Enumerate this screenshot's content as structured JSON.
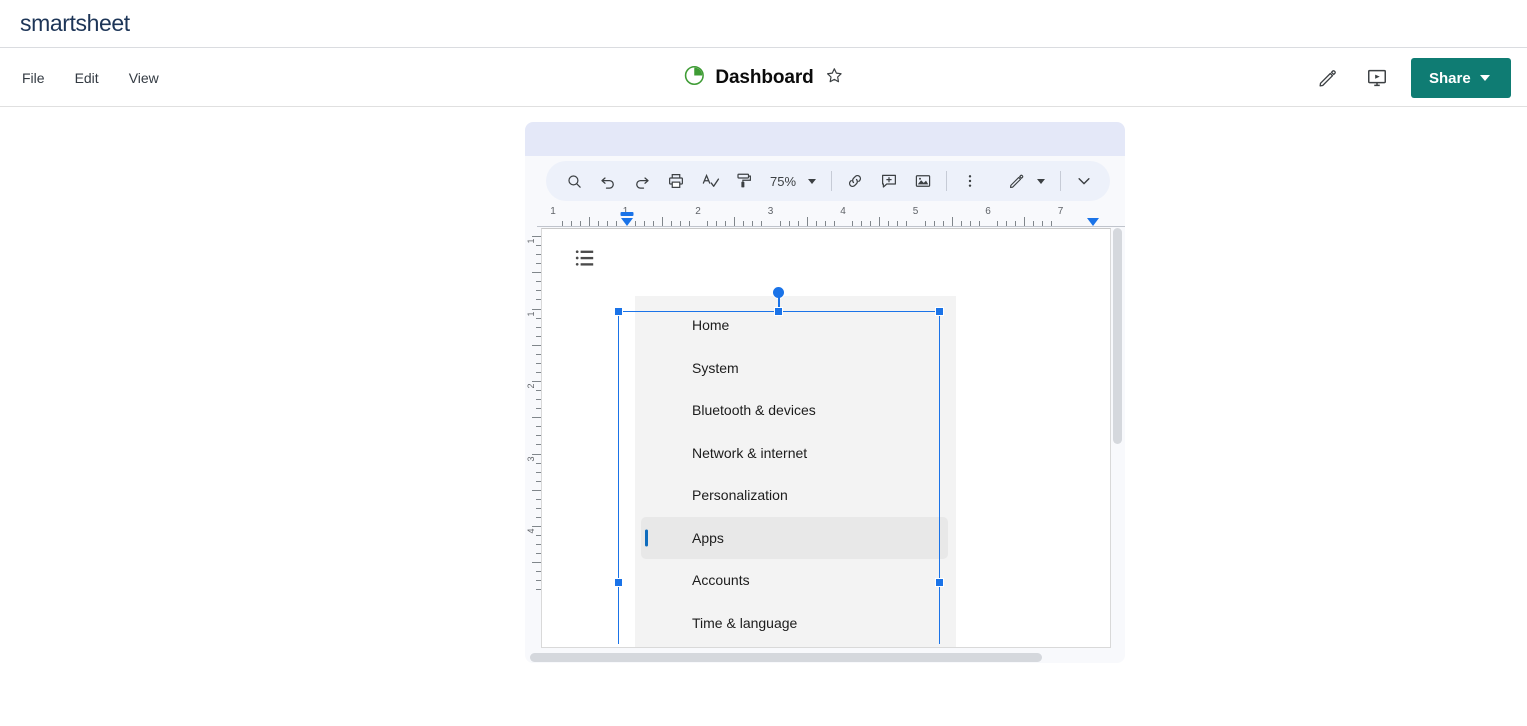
{
  "brand": {
    "name": "smartsheet",
    "color": "#1d3557"
  },
  "header": {
    "menus": [
      {
        "label": "File",
        "name": "menu-file"
      },
      {
        "label": "Edit",
        "name": "menu-edit"
      },
      {
        "label": "View",
        "name": "menu-view"
      }
    ],
    "title": "Dashboard",
    "title_icon": "pie-chart-icon",
    "star_icon": "star-outline-icon",
    "actions": [
      {
        "label": "Edit",
        "icon": "pencil-icon"
      },
      {
        "label": "Presentation mode",
        "icon": "presentation-icon"
      }
    ],
    "share": {
      "label": "Share",
      "color": "#0f7c73",
      "caret": "chevron-down-icon"
    }
  },
  "widget": {
    "toolbar": {
      "icons": [
        {
          "name": "search-icon",
          "title": "Search"
        },
        {
          "name": "undo-icon",
          "title": "Undo"
        },
        {
          "name": "redo-icon",
          "title": "Redo"
        },
        {
          "name": "print-icon",
          "title": "Print"
        },
        {
          "name": "spellcheck-icon",
          "title": "Spelling and grammar check"
        },
        {
          "name": "paint-format-icon",
          "title": "Paint format"
        }
      ],
      "zoom": {
        "value": "75%",
        "caret": "chevron-down-icon"
      },
      "icons2": [
        {
          "name": "link-icon",
          "title": "Insert link"
        },
        {
          "name": "comment-icon",
          "title": "Add comment"
        },
        {
          "name": "image-icon",
          "title": "Insert image"
        }
      ],
      "more": {
        "name": "more-vertical-icon",
        "title": "More"
      },
      "mode": {
        "name": "editing-mode-pencil-icon",
        "title": "Editing mode",
        "caret": "chevron-down-icon"
      },
      "collapse": {
        "name": "chevron-down-icon",
        "title": "Hide the menus"
      }
    },
    "h_ruler": {
      "numbers": [
        "1",
        "1",
        "2",
        "3",
        "4",
        "5",
        "6",
        "7"
      ]
    },
    "v_ruler": {
      "numbers": [
        "1",
        "1",
        "2",
        "3",
        "4"
      ]
    },
    "document": {
      "bullet_list_icon": "bulleted-list-icon"
    },
    "settings_image": {
      "items": [
        {
          "label": "Home",
          "selected": false
        },
        {
          "label": "System",
          "selected": false
        },
        {
          "label": "Bluetooth & devices",
          "selected": false
        },
        {
          "label": "Network & internet",
          "selected": false
        },
        {
          "label": "Personalization",
          "selected": false
        },
        {
          "label": "Apps",
          "selected": true
        },
        {
          "label": "Accounts",
          "selected": false
        },
        {
          "label": "Time & language",
          "selected": false
        }
      ],
      "selected_accent": "#0f6cbd",
      "background": "#f3f3f3"
    },
    "selection": {
      "accent": "#1a73e8",
      "handles": 6,
      "rotation_handle": true
    }
  }
}
